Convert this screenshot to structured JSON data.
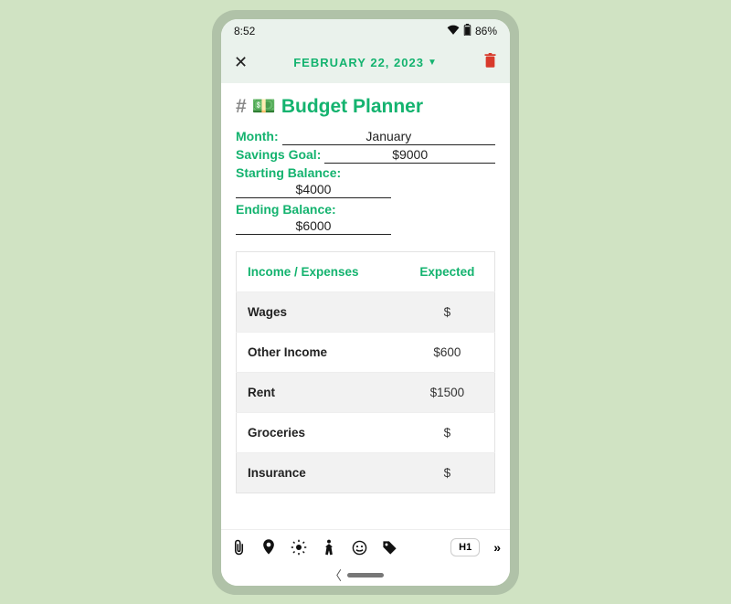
{
  "status": {
    "time": "8:52",
    "battery": "86%"
  },
  "appbar": {
    "date": "FEBRUARY 22, 2023"
  },
  "title": {
    "hash": "#",
    "emoji": "💵",
    "text": "Budget Planner"
  },
  "fields": {
    "month_label": "Month:",
    "month_value": "January",
    "savings_label": "Savings Goal:",
    "savings_value": "$9000",
    "startbal_label": "Starting Balance:",
    "startbal_value": "$4000",
    "endbal_label": "Ending Balance:",
    "endbal_value": "$6000"
  },
  "table": {
    "col1": "Income / Expenses",
    "col2": "Expected",
    "rows": [
      {
        "name": "Wages",
        "expected": "$"
      },
      {
        "name": "Other Income",
        "expected": "$600"
      },
      {
        "name": "Rent",
        "expected": "$1500"
      },
      {
        "name": "Groceries",
        "expected": "$"
      },
      {
        "name": "Insurance",
        "expected": "$"
      }
    ]
  },
  "toolbar": {
    "h1": "H1"
  }
}
